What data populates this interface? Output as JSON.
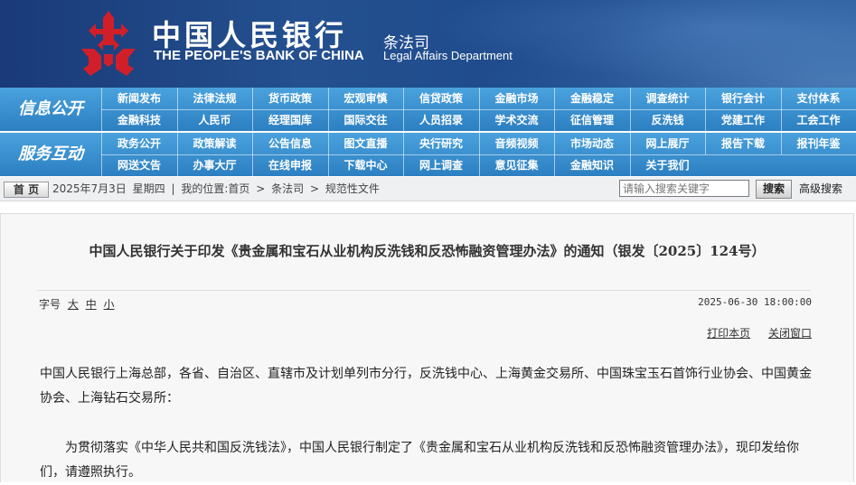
{
  "header": {
    "bank_name_cn": "中国人民银行",
    "bank_name_en": "THE PEOPLE'S BANK OF CHINA",
    "dept_cn": "条法司",
    "dept_en": "Legal Affairs Department",
    "logo_color": "#d11f2a"
  },
  "nav": {
    "row1_label": "信息公开",
    "row2_label": "服务互动",
    "row1_items": [
      "新闻发布",
      "法律法规",
      "货币政策",
      "宏观审慎",
      "信贷政策",
      "金融市场",
      "金融稳定",
      "调查统计",
      "银行会计",
      "支付体系",
      "金融科技",
      "人民币",
      "经理国库",
      "国际交往",
      "人员招录",
      "学术交流",
      "征信管理",
      "反洗钱",
      "党建工作",
      "工会工作"
    ],
    "row2_items": [
      "政务公开",
      "政策解读",
      "公告信息",
      "图文直播",
      "央行研究",
      "音频视频",
      "市场动态",
      "网上展厅",
      "报告下载",
      "报刊年鉴",
      "网送文告",
      "办事大厅",
      "在线申报",
      "下载中心",
      "网上调查",
      "意见征集",
      "金融知识",
      "关于我们"
    ]
  },
  "crumb": {
    "home": "首 页",
    "date": "2025年7月3日",
    "weekday": "星期四",
    "location_label": "我的位置:首页",
    "sep": ">",
    "level1": "条法司",
    "level2": "规范性文件",
    "search_placeholder": "请输入搜索关键字",
    "search_button": "搜索",
    "advanced": "高级搜索"
  },
  "article": {
    "title": "中国人民银行关于印发《贵金属和宝石从业机构反洗钱和反恐怖融资管理办法》的通知（银发〔2025〕124号）",
    "fontsize_label": "字号",
    "fontsize_large": "大",
    "fontsize_medium": "中",
    "fontsize_small": "小",
    "date": "2025-06-30 18:00:00",
    "print": "打印本页",
    "close": "关闭窗口",
    "para1": "中国人民银行上海总部，各省、自治区、直辖市及计划单列市分行，反洗钱中心、上海黄金交易所、中国珠宝玉石首饰行业协会、中国黄金协会、上海钻石交易所：",
    "para2": "为贯彻落实《中华人民共和国反洗钱法》，中国人民银行制定了《贵金属和宝石从业机构反洗钱和反恐怖融资管理办法》，现印发给你们，请遵照执行。"
  }
}
